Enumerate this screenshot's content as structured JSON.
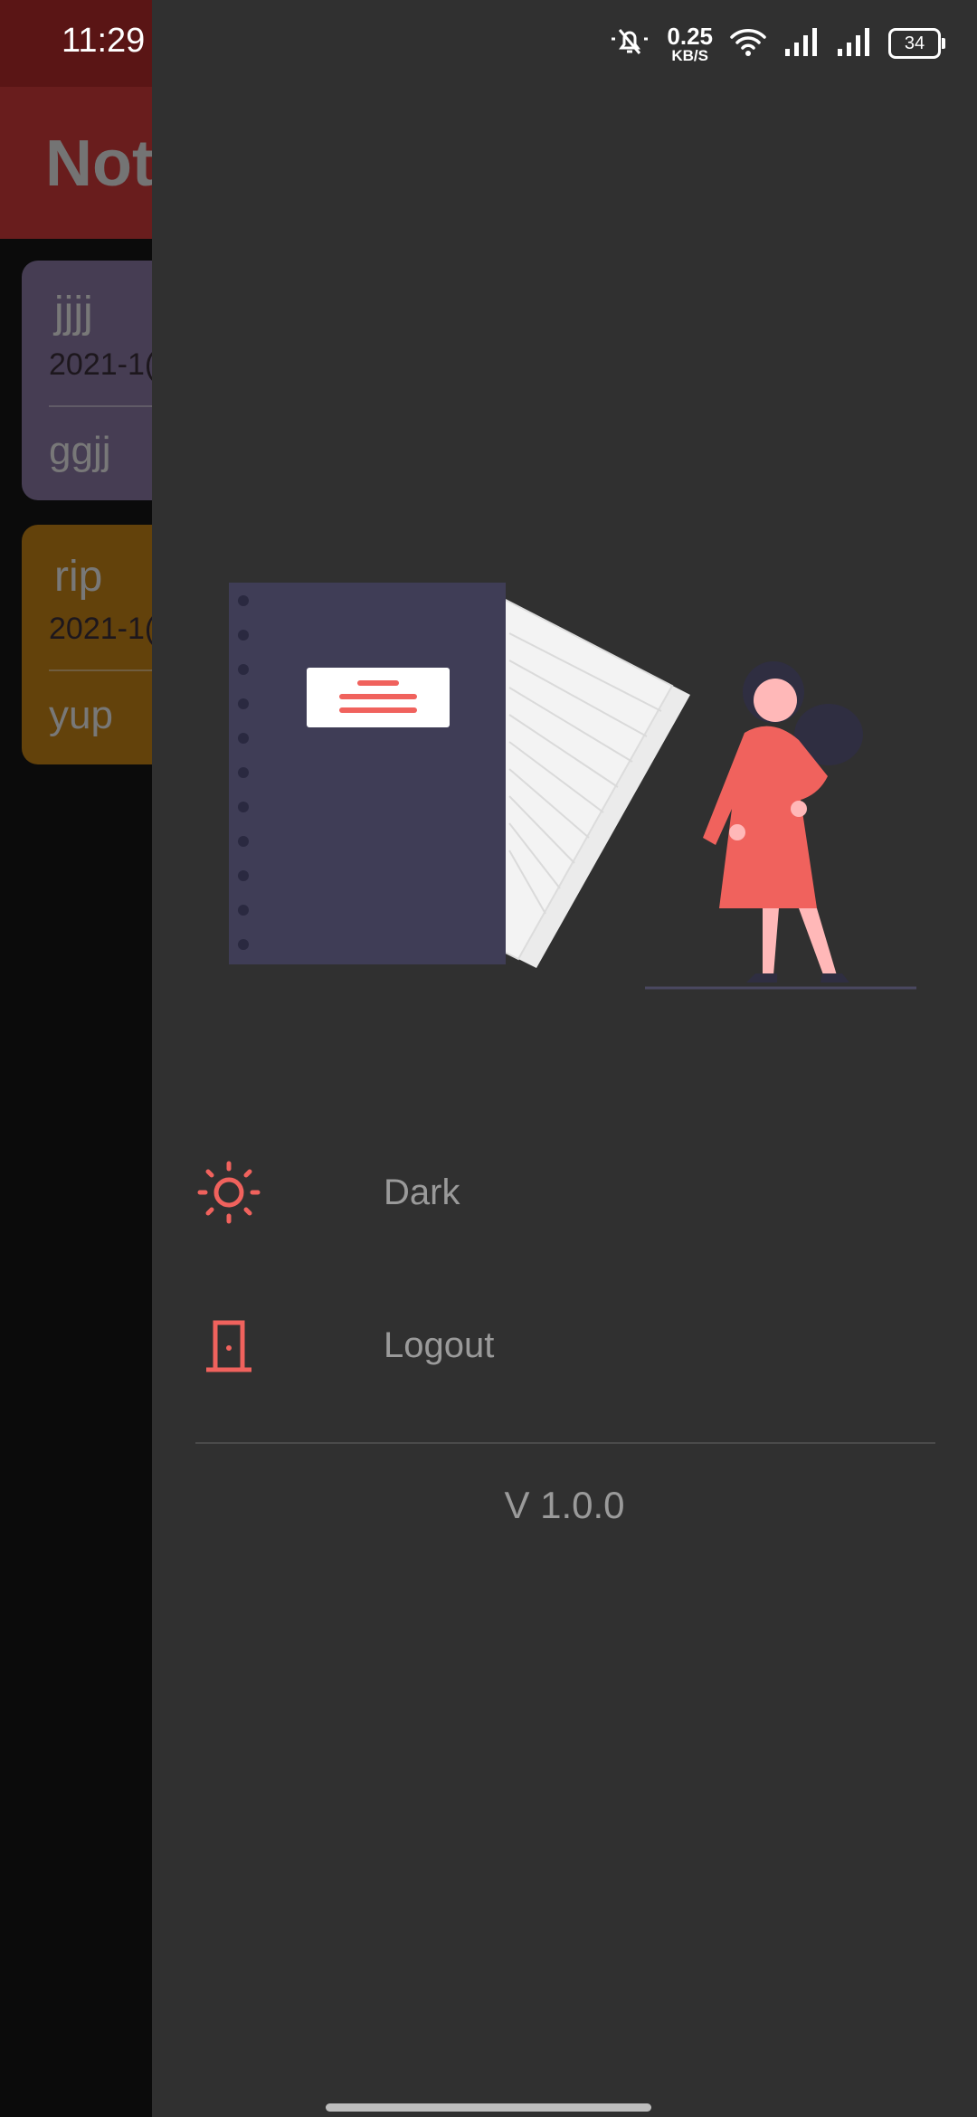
{
  "status_bar": {
    "time": "11:29",
    "net_speed_value": "0.25",
    "net_speed_unit": "KB/S",
    "battery": "34",
    "icons": [
      "bell-muted-icon",
      "wifi-icon",
      "signal-icon",
      "signal-icon",
      "battery-icon"
    ]
  },
  "background_app": {
    "title": "Not",
    "notes": [
      {
        "title": "jjjj",
        "date": "2021-1(",
        "body": "ggjj",
        "color": "#8c7aa7"
      },
      {
        "title": "rip",
        "date": "2021-1(",
        "body": "yup",
        "color": "#c78417"
      }
    ]
  },
  "drawer": {
    "menu": [
      {
        "label": "Dark",
        "icon": "sun-icon"
      },
      {
        "label": "Logout",
        "icon": "door-icon"
      }
    ],
    "version": "V 1.0.0",
    "colors": {
      "accent": "#f0625d",
      "drawer_bg": "#303030",
      "notebook": "#3f3d56"
    }
  }
}
